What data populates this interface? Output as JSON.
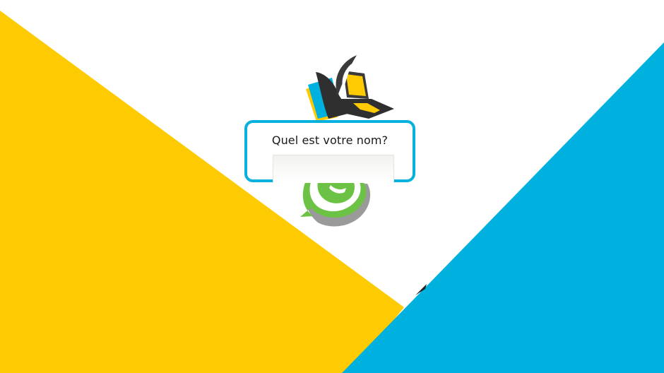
{
  "colors": {
    "background": "#ffffff",
    "yellow": "#fecb02",
    "blue": "#00b1df",
    "dialog_border": "#08b1dd",
    "logo_dark": "#333333",
    "whatsapp_green": "#6cc244"
  },
  "icons": {
    "logo": "book-laptop-logo-icon",
    "chat": "whatsapp-icon"
  },
  "dialog": {
    "title": "Quel est votre nom?",
    "input_value": "",
    "input_placeholder": ""
  }
}
